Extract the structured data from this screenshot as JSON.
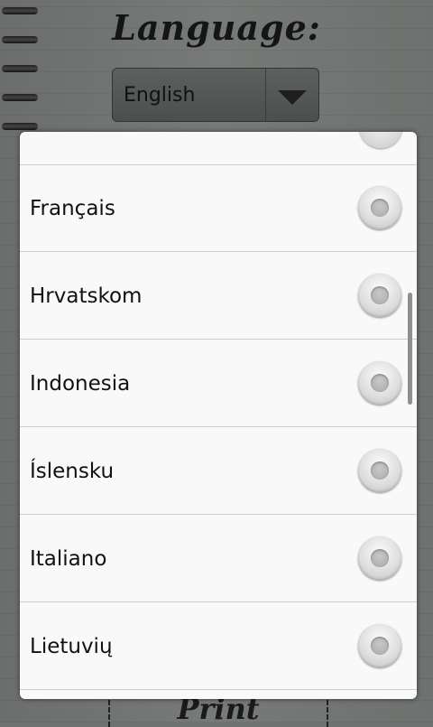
{
  "background": {
    "title": "Language:",
    "selected_language": "English",
    "footer_text": "Print"
  },
  "dialog": {
    "items": [
      {
        "label": "Français",
        "selected": false
      },
      {
        "label": "Hrvatskom",
        "selected": false
      },
      {
        "label": "Indonesia",
        "selected": false
      },
      {
        "label": "Íslensku",
        "selected": false
      },
      {
        "label": "Italiano",
        "selected": false
      },
      {
        "label": "Lietuvių",
        "selected": false
      }
    ],
    "scroll_position": 0.4
  },
  "colors": {
    "dialog_background": "#f9f9fa",
    "divider": "#cdcdcd",
    "text": "#111111",
    "overlay_dim": "#6f7270"
  }
}
